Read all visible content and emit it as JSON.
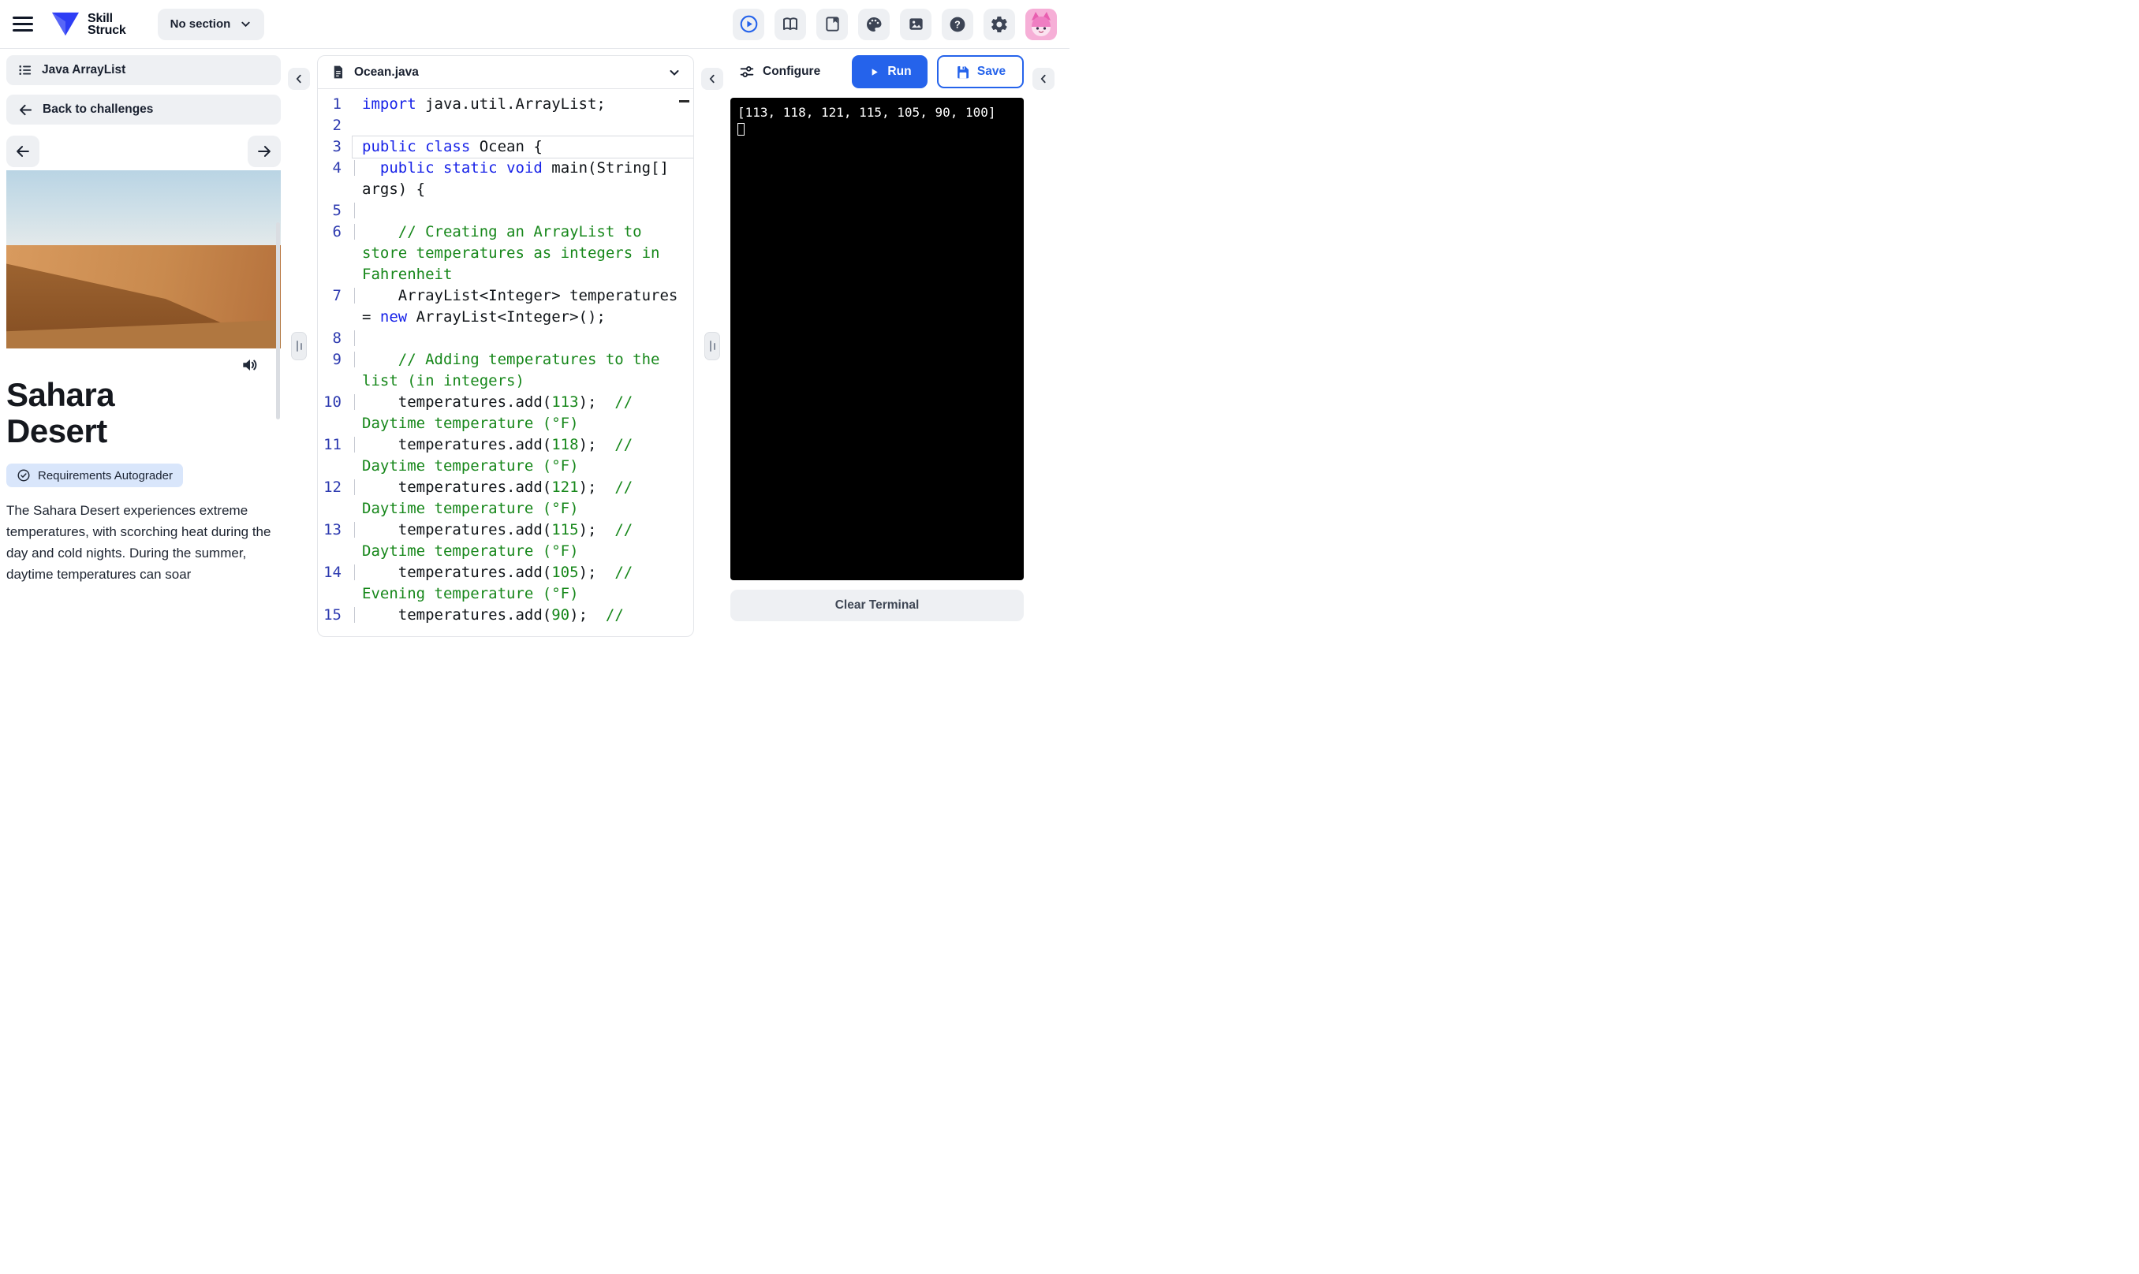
{
  "header": {
    "logo": {
      "line1": "Skill",
      "line2": "Struck"
    },
    "section_dropdown": {
      "label": "No section"
    },
    "toolbar_icons": [
      "play-circle",
      "book-open",
      "library-book",
      "palette",
      "image",
      "help",
      "settings"
    ],
    "avatar_name": "profile-avatar"
  },
  "colors": {
    "accent_blue": "#2563eb",
    "keyword_blue": "#1722e8",
    "comment_green": "#16871a",
    "line_number_blue": "#2e3bb0",
    "badge_bg": "#d9e6fb",
    "panel_gray": "#eef0f3",
    "terminal_bg": "#000000"
  },
  "left_panel": {
    "course_title": "Java ArrayList",
    "back_label": "Back to challenges",
    "challenge": {
      "title_line1": "Sahara",
      "title_line2": "Desert",
      "badge_label": "Requirements Autograder",
      "description": "The Sahara Desert experiences extreme temperatures, with scorching heat during the day and cold nights. During the summer, daytime temperatures can soar"
    }
  },
  "editor": {
    "filename": "Ocean.java",
    "lines": [
      {
        "num": 1,
        "tokens": [
          {
            "t": "kw",
            "v": "import"
          },
          {
            "t": "pl",
            "v": " java.util.ArrayList;"
          }
        ]
      },
      {
        "num": 2,
        "tokens": []
      },
      {
        "num": 3,
        "active": true,
        "tokens": [
          {
            "t": "kw",
            "v": "public"
          },
          {
            "t": "pl",
            "v": " "
          },
          {
            "t": "kw",
            "v": "class"
          },
          {
            "t": "pl",
            "v": " Ocean {"
          }
        ]
      },
      {
        "num": 4,
        "guide": true,
        "tokens": [
          {
            "t": "pl",
            "v": "  "
          },
          {
            "t": "kw",
            "v": "public"
          },
          {
            "t": "pl",
            "v": " "
          },
          {
            "t": "kw",
            "v": "static"
          },
          {
            "t": "pl",
            "v": " "
          },
          {
            "t": "kw",
            "v": "void"
          },
          {
            "t": "pl",
            "v": " main(String[] args) {"
          }
        ]
      },
      {
        "num": 5,
        "guide": true,
        "tokens": []
      },
      {
        "num": 6,
        "guide": true,
        "tokens": [
          {
            "t": "pl",
            "v": "    "
          },
          {
            "t": "cm",
            "v": "// Creating an ArrayList to store temperatures as integers in Fahrenheit"
          }
        ]
      },
      {
        "num": 7,
        "guide": true,
        "tokens": [
          {
            "t": "pl",
            "v": "    ArrayList<Integer> temperatures = "
          },
          {
            "t": "kw",
            "v": "new"
          },
          {
            "t": "pl",
            "v": " ArrayList<Integer>();"
          }
        ]
      },
      {
        "num": 8,
        "guide": true,
        "tokens": []
      },
      {
        "num": 9,
        "guide": true,
        "tokens": [
          {
            "t": "pl",
            "v": "    "
          },
          {
            "t": "cm",
            "v": "// Adding temperatures to the list (in integers)"
          }
        ]
      },
      {
        "num": 10,
        "guide": true,
        "tokens": [
          {
            "t": "pl",
            "v": "    temperatures.add("
          },
          {
            "t": "nm",
            "v": "113"
          },
          {
            "t": "pl",
            "v": ");  "
          },
          {
            "t": "cm",
            "v": "// Daytime temperature (°F)"
          }
        ]
      },
      {
        "num": 11,
        "guide": true,
        "tokens": [
          {
            "t": "pl",
            "v": "    temperatures.add("
          },
          {
            "t": "nm",
            "v": "118"
          },
          {
            "t": "pl",
            "v": ");  "
          },
          {
            "t": "cm",
            "v": "// Daytime temperature (°F)"
          }
        ]
      },
      {
        "num": 12,
        "guide": true,
        "tokens": [
          {
            "t": "pl",
            "v": "    temperatures.add("
          },
          {
            "t": "nm",
            "v": "121"
          },
          {
            "t": "pl",
            "v": ");  "
          },
          {
            "t": "cm",
            "v": "// Daytime temperature (°F)"
          }
        ]
      },
      {
        "num": 13,
        "guide": true,
        "tokens": [
          {
            "t": "pl",
            "v": "    temperatures.add("
          },
          {
            "t": "nm",
            "v": "115"
          },
          {
            "t": "pl",
            "v": ");  "
          },
          {
            "t": "cm",
            "v": "// Daytime temperature (°F)"
          }
        ]
      },
      {
        "num": 14,
        "guide": true,
        "tokens": [
          {
            "t": "pl",
            "v": "    temperatures.add("
          },
          {
            "t": "nm",
            "v": "105"
          },
          {
            "t": "pl",
            "v": ");  "
          },
          {
            "t": "cm",
            "v": "// Evening temperature (°F)"
          }
        ]
      },
      {
        "num": 15,
        "guide": true,
        "tokens": [
          {
            "t": "pl",
            "v": "    temperatures.add("
          },
          {
            "t": "nm",
            "v": "90"
          },
          {
            "t": "pl",
            "v": ");  "
          },
          {
            "t": "cm",
            "v": "//"
          }
        ]
      }
    ]
  },
  "output_panel": {
    "configure_label": "Configure",
    "run_label": "Run",
    "save_label": "Save",
    "terminal": {
      "output_line": "[113, 118, 121, 115, 105, 90, 100]"
    },
    "clear_label": "Clear Terminal"
  }
}
